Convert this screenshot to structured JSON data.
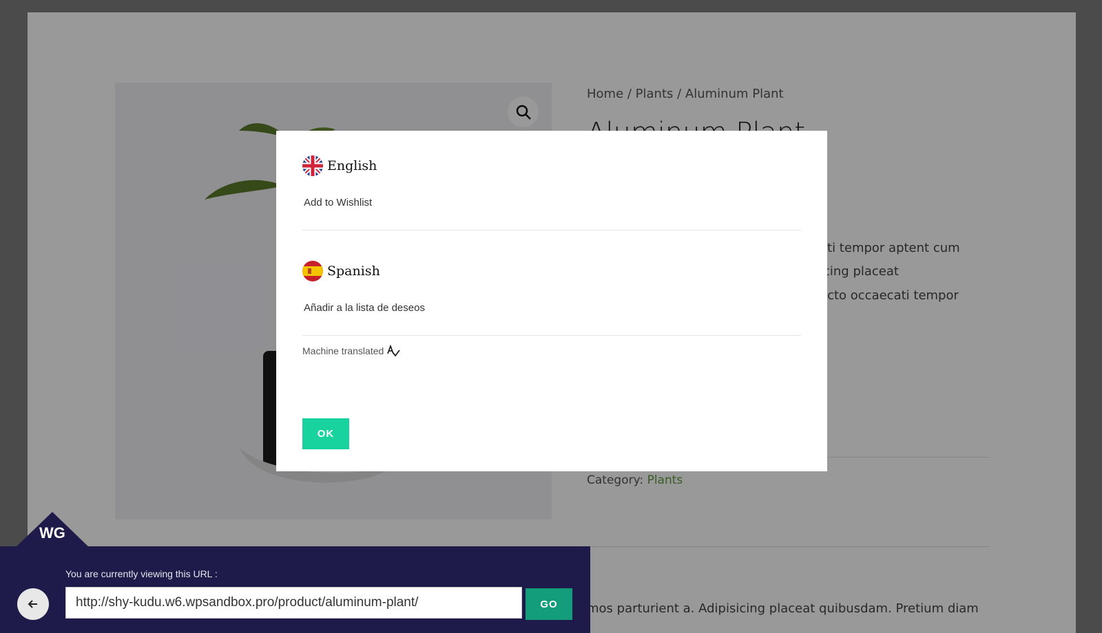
{
  "page": {
    "breadcrumb": "Home / Plants / Aluminum Plant",
    "title": "Aluminum Plant",
    "desc_lines": [
      "ati tempor aptent cum",
      "icing placeat",
      "ecto occaecati tempor"
    ],
    "category_label": "Category:",
    "category_link": "Plants",
    "desc_bottom": "mos parturient a. Adipisicing placeat quibusdam. Pretium diam"
  },
  "modal": {
    "source": {
      "lang": "English",
      "text": "Add to Wishlist",
      "flag_icon": "uk-flag-icon"
    },
    "target": {
      "lang": "Spanish",
      "text": "Añadir a la lista de deseos",
      "flag_icon": "spain-flag-icon"
    },
    "machine_label": "Machine translated",
    "ok_label": "OK"
  },
  "urlbar": {
    "label": "You are currently viewing this URL :",
    "url": "http://shy-kudu.w6.wpsandbox.pro/product/aluminum-plant/",
    "go_label": "GO",
    "logo_text": "WG"
  },
  "colors": {
    "ok_button": "#18d39e",
    "go_button": "#139d7a",
    "url_panel": "#1e1a4a",
    "category_link": "#5f9a3a"
  }
}
